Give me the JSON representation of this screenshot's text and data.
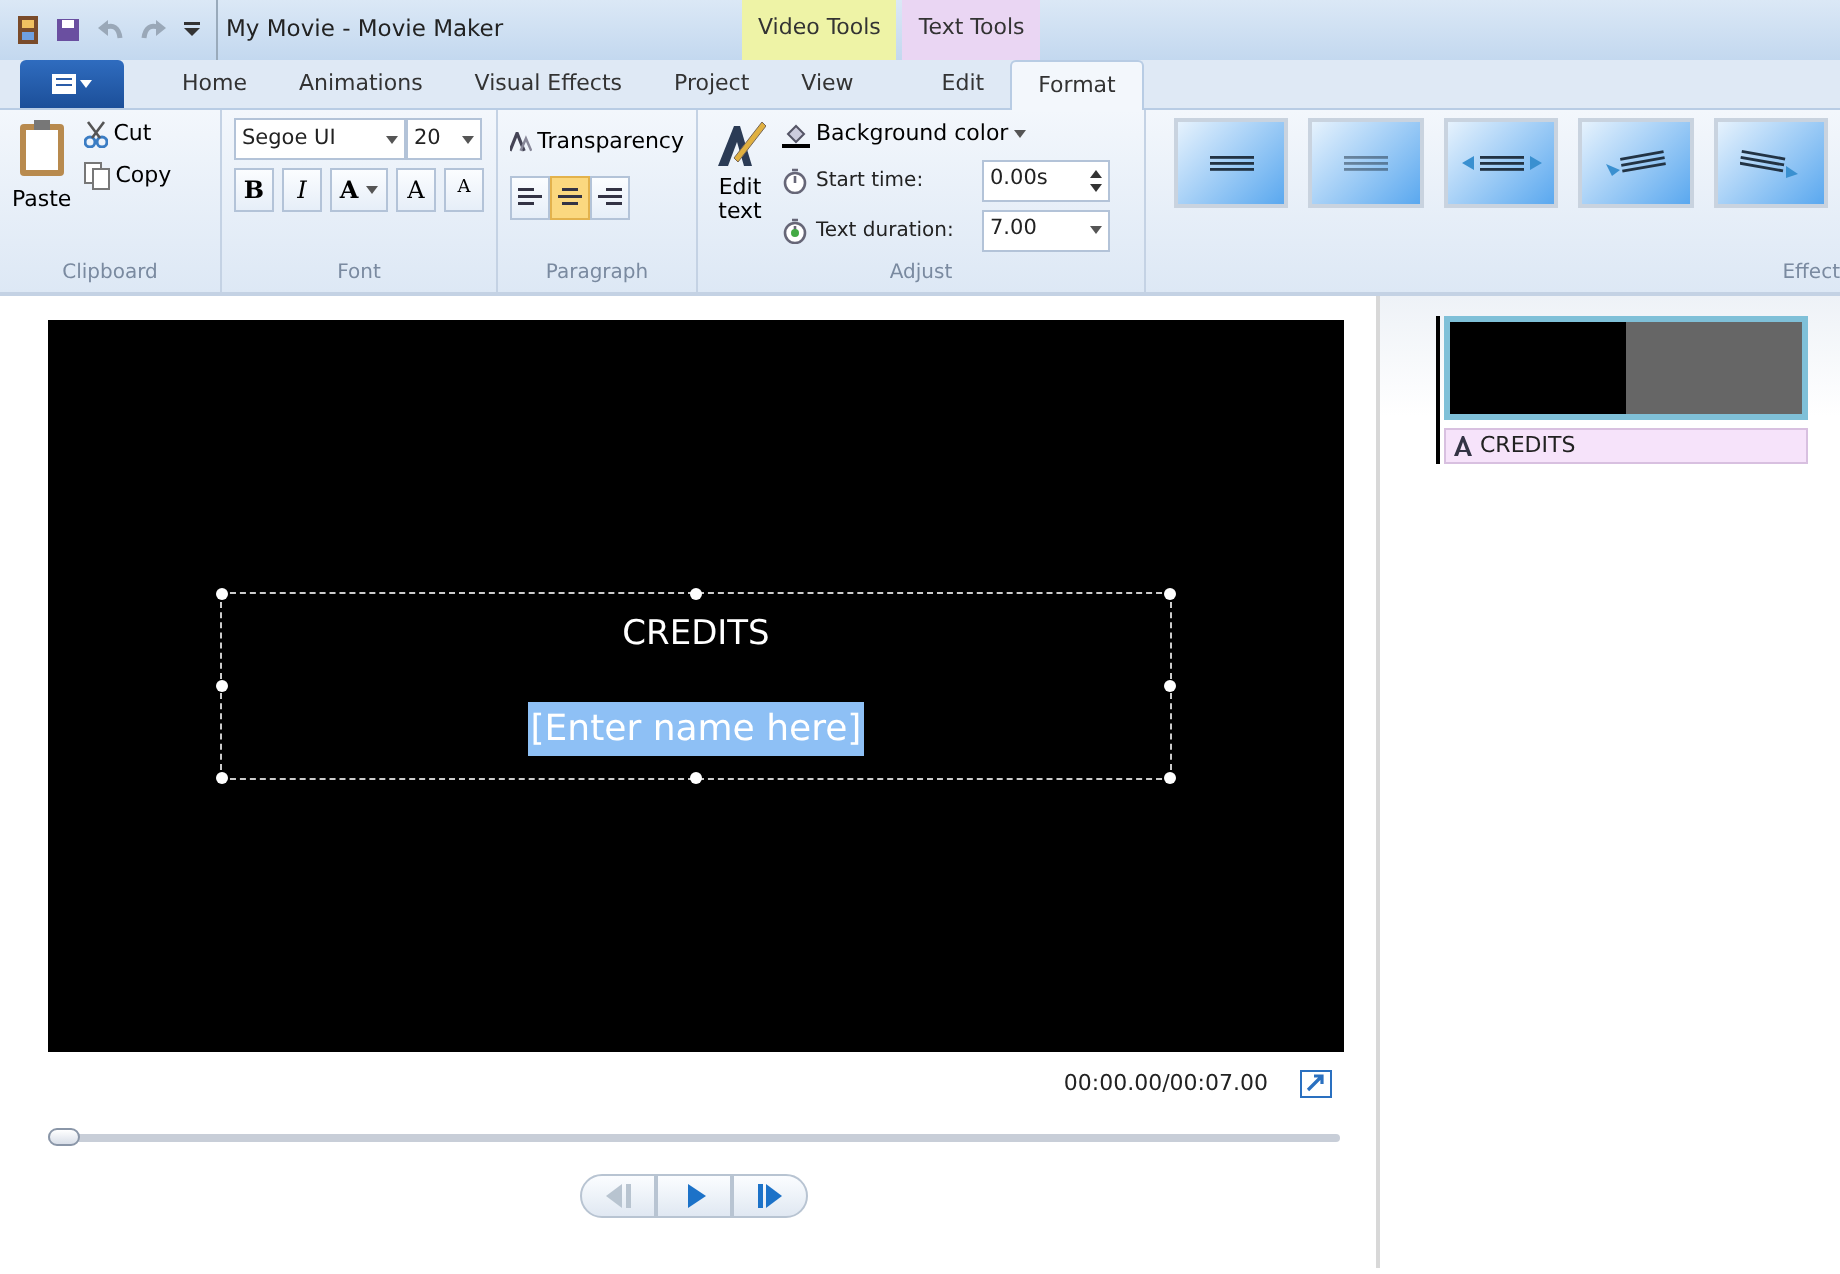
{
  "window": {
    "title": "My Movie - Movie Maker"
  },
  "contextual_tabs": [
    {
      "label": "Video Tools",
      "color": "#eef3a6"
    },
    {
      "label": "Text Tools",
      "color": "#ead6f3"
    }
  ],
  "tabs": [
    {
      "label": "Home",
      "selected": false
    },
    {
      "label": "Animations",
      "selected": false
    },
    {
      "label": "Visual Effects",
      "selected": false
    },
    {
      "label": "Project",
      "selected": false
    },
    {
      "label": "View",
      "selected": false
    },
    {
      "label": "Edit",
      "selected": false
    },
    {
      "label": "Format",
      "selected": true
    }
  ],
  "clipboard": {
    "paste": "Paste",
    "cut": "Cut",
    "copy": "Copy",
    "label": "Clipboard"
  },
  "font": {
    "family": "Segoe UI",
    "size": "20",
    "bold": "B",
    "italic": "I",
    "font_color_letter": "A",
    "grow": "A",
    "shrink": "A",
    "label": "Font"
  },
  "paragraph": {
    "transparency": "Transparency",
    "align": [
      {
        "kind": "left",
        "selected": false
      },
      {
        "kind": "center",
        "selected": true
      },
      {
        "kind": "right",
        "selected": false
      }
    ],
    "label": "Paragraph"
  },
  "adjust": {
    "edit_text": "Edit text",
    "background_color": "Background color",
    "start_time_label": "Start time:",
    "start_time": "0.00s",
    "duration_label": "Text duration:",
    "duration": "7.00",
    "label": "Adjust"
  },
  "effects": {
    "label": "Effect"
  },
  "preview": {
    "title": "CREDITS",
    "selected_text": "[Enter name here]",
    "time": "00:00.00/00:07.00",
    "seek": {
      "level": 0
    }
  },
  "storyboard": {
    "caption": "CREDITS"
  }
}
